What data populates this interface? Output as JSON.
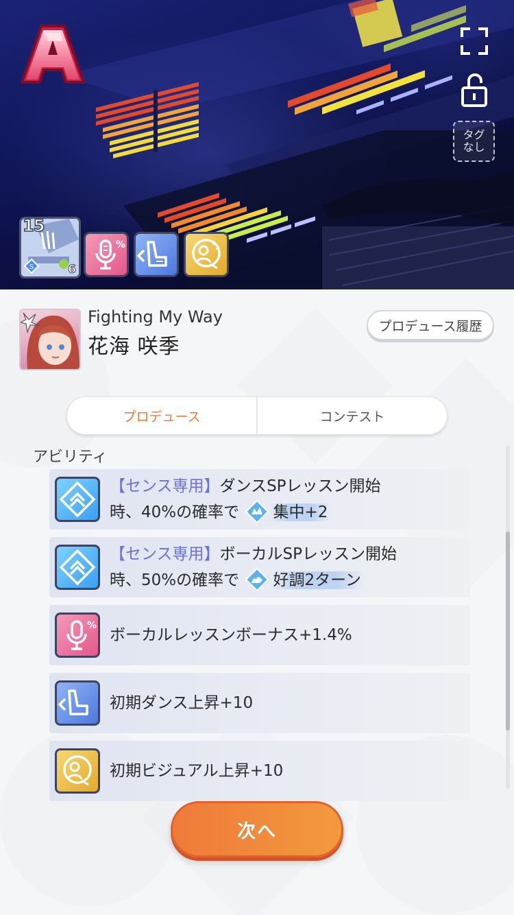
{
  "hero": {
    "rank_letter": "A",
    "tag_button_label": "タグ\nなし",
    "card_level": "15",
    "card_bottom_number": "6",
    "skill_icons": [
      "vocal-icon",
      "dance-icon",
      "visual-icon"
    ]
  },
  "card": {
    "title": "Fighting My Way",
    "character_name": "花海 咲季",
    "history_button": "プロデュース履歴"
  },
  "tabs": [
    {
      "label": "プロデュース",
      "active": true
    },
    {
      "label": "コンテスト",
      "active": false
    }
  ],
  "section_label": "アビリティ",
  "abilities": [
    {
      "icon": "sense-icon",
      "tag": "【センス専用】",
      "line1": "ダンスSPレッスン開始",
      "line2_pre": "時、40%の確率で",
      "inline_icon": "concentration-icon",
      "line2_post": "集中+2"
    },
    {
      "icon": "sense-icon",
      "tag": "【センス専用】",
      "line1": "ボーカルSPレッスン開始",
      "line2_pre": "時、50%の確率で",
      "inline_icon": "good-condition-icon",
      "line2_post": "好調2ターン"
    },
    {
      "icon": "vocal-icon",
      "text": "ボーカルレッスンボーナス+1.4%"
    },
    {
      "icon": "dance-icon",
      "text": "初期ダンス上昇+10"
    },
    {
      "icon": "visual-icon",
      "text": "初期ビジュアル上昇+10"
    }
  ],
  "next_button": "次へ",
  "colors": {
    "accent": "#f07a30",
    "sense_tag": "#6a72e0"
  }
}
